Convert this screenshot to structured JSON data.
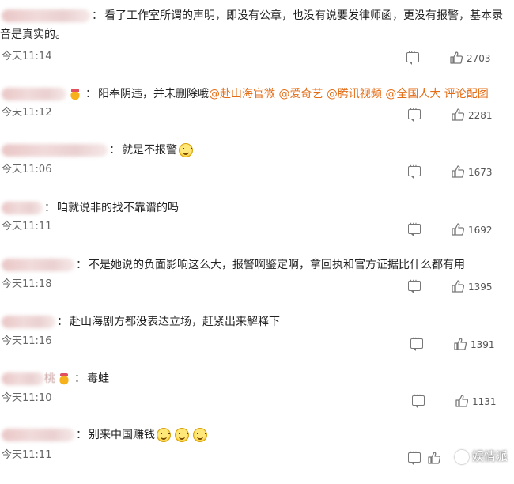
{
  "comments": [
    {
      "username_blurred": true,
      "has_crown": false,
      "text": "看了工作室所谓的声明，即没有公章，也没有说要发律师函，更没有报警，基本录",
      "text_cont": "音是真实的。",
      "time": "今天11:14",
      "likes": "2703"
    },
    {
      "username_blurred": true,
      "has_crown": true,
      "text": "阳奉阴违，并未删除哦",
      "mentions": "@赴山海官微 @爱奇艺 @腾讯视频 @全国人大 评论配图",
      "time": "今天11:12",
      "likes": "2281"
    },
    {
      "username_blurred": true,
      "has_crown": false,
      "text": "就是不报警",
      "time": "今天11:06",
      "likes": "1673"
    },
    {
      "username_blurred": true,
      "has_crown": false,
      "text": "咱就说非的找不靠谱的吗",
      "time": "今天11:11",
      "likes": "1692"
    },
    {
      "username_blurred": true,
      "has_crown": false,
      "text": "不是她说的负面影响这么大，报警啊鉴定啊，拿回执和官方证据比什么都有用",
      "time": "今天11:18",
      "likes": "1395"
    },
    {
      "username_blurred": true,
      "has_crown": false,
      "text": "赴山海剧方都没表达立场，赶紧出来解释下",
      "time": "今天11:16",
      "likes": "1391"
    },
    {
      "username_blurred": true,
      "username_visible_tail": "桃",
      "has_crown": true,
      "text": "毒蛙",
      "time": "今天11:10",
      "likes": "1131"
    },
    {
      "username_blurred": true,
      "has_crown": false,
      "text": "别来中国赚钱",
      "time": "今天11:11",
      "likes": ""
    }
  ],
  "icons": {
    "comment": "comment-icon",
    "like": "thumbs-up-icon",
    "emoji": "smile-emoji-icon",
    "crown": "crown-badge-icon"
  },
  "watermark": "娱情派",
  "colors": {
    "mention": "#e46c14",
    "text": "#222222",
    "meta": "#666666"
  }
}
